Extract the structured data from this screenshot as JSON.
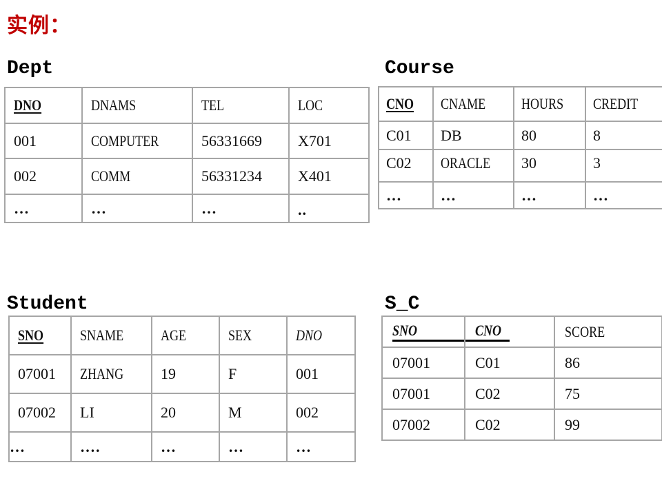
{
  "page": {
    "title": "实例：",
    "title_color": "#c00000"
  },
  "dept": {
    "name": "Dept",
    "columns": [
      "DNO",
      "DNAMS",
      "TEL",
      "LOC"
    ],
    "rows": [
      [
        "001",
        "COMPUTER",
        "56331669",
        "X701"
      ],
      [
        "002",
        "COMM",
        "56331234",
        "X401"
      ],
      [
        "…",
        "…",
        "…",
        ".."
      ]
    ]
  },
  "course": {
    "name": "Course",
    "columns": [
      "CNO",
      "CNAME",
      "HOURS",
      "CREDIT"
    ],
    "rows": [
      [
        "C01",
        "DB",
        "80",
        "8"
      ],
      [
        "C02",
        "ORACLE",
        "30",
        "3"
      ],
      [
        "…",
        "…",
        "…",
        "…"
      ]
    ]
  },
  "student": {
    "name": "Student",
    "columns": [
      "SNO",
      "SNAME",
      "AGE",
      "SEX",
      "DNO"
    ],
    "rows": [
      [
        "07001",
        "ZHANG",
        "19",
        "F",
        "001"
      ],
      [
        "07002",
        "LI",
        "20",
        "M",
        "002"
      ],
      [
        "…",
        "….",
        "…",
        "…",
        "…"
      ]
    ]
  },
  "sc": {
    "name": "S_C",
    "columns": [
      "SNO",
      "CNO",
      "SCORE"
    ],
    "rows": [
      [
        "07001",
        "C01",
        "86"
      ],
      [
        "07001",
        "C02",
        "75"
      ],
      [
        "07002",
        "C02",
        "99"
      ]
    ]
  }
}
